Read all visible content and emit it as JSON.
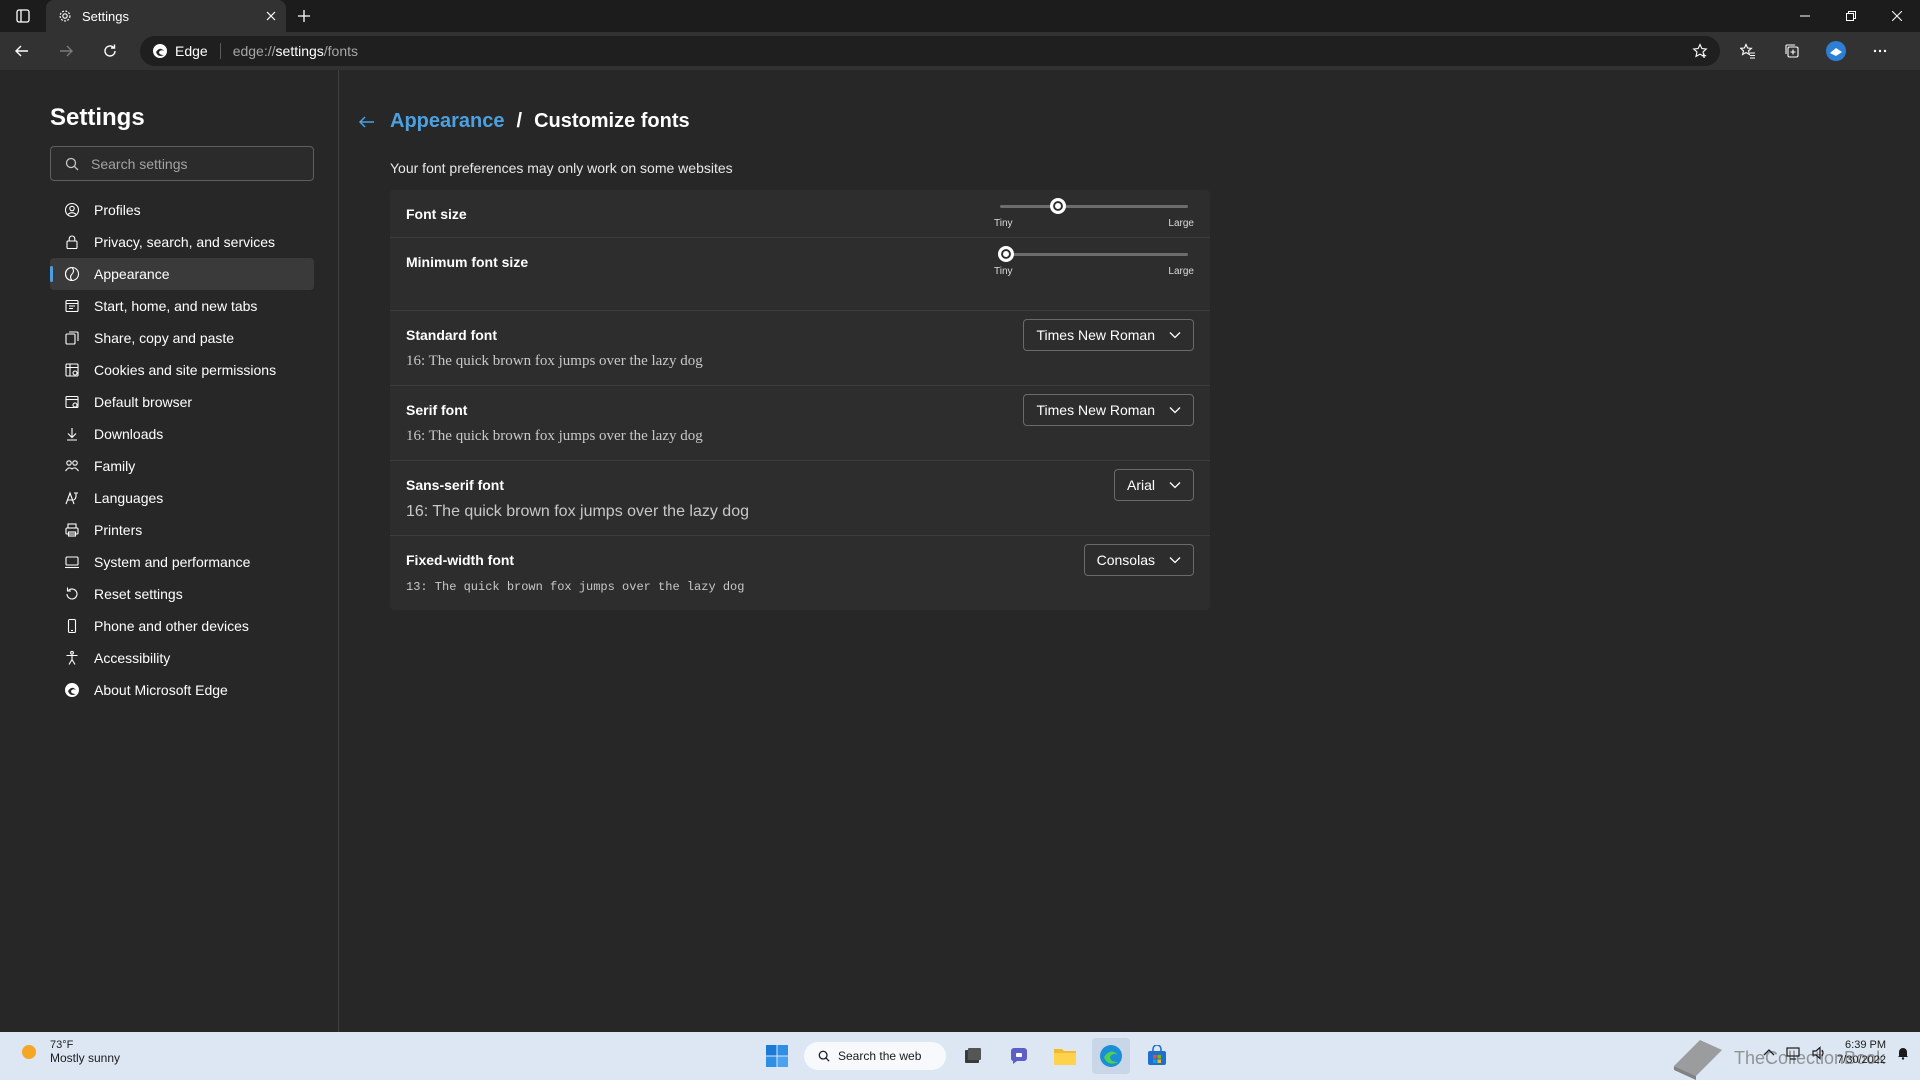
{
  "browser": {
    "tab_title": "Settings",
    "address_brand": "Edge",
    "url_prefix": "edge://",
    "url_bold": "settings",
    "url_suffix": "/fonts"
  },
  "sidebar": {
    "title": "Settings",
    "search_placeholder": "Search settings",
    "items": [
      {
        "label": "Profiles",
        "icon": "profile-icon"
      },
      {
        "label": "Privacy, search, and services",
        "icon": "lock-icon"
      },
      {
        "label": "Appearance",
        "icon": "appearance-icon",
        "active": true
      },
      {
        "label": "Start, home, and new tabs",
        "icon": "home-icon"
      },
      {
        "label": "Share, copy and paste",
        "icon": "share-icon"
      },
      {
        "label": "Cookies and site permissions",
        "icon": "cookies-icon"
      },
      {
        "label": "Default browser",
        "icon": "browser-icon"
      },
      {
        "label": "Downloads",
        "icon": "download-icon"
      },
      {
        "label": "Family",
        "icon": "family-icon"
      },
      {
        "label": "Languages",
        "icon": "language-icon"
      },
      {
        "label": "Printers",
        "icon": "printer-icon"
      },
      {
        "label": "System and performance",
        "icon": "system-icon"
      },
      {
        "label": "Reset settings",
        "icon": "reset-icon"
      },
      {
        "label": "Phone and other devices",
        "icon": "phone-icon"
      },
      {
        "label": "Accessibility",
        "icon": "accessibility-icon"
      },
      {
        "label": "About Microsoft Edge",
        "icon": "edge-icon"
      }
    ]
  },
  "main": {
    "breadcrumb_parent": "Appearance",
    "breadcrumb_separator": "/",
    "breadcrumb_current": "Customize fonts",
    "note": "Your font preferences may only work on some websites",
    "font_size": {
      "label": "Font size",
      "min_label": "Tiny",
      "max_label": "Large",
      "level": 0.3
    },
    "min_font_size": {
      "label": "Minimum font size",
      "min_label": "Tiny",
      "max_label": "Large",
      "level": 0.0
    },
    "standard_font": {
      "label": "Standard font",
      "value": "Times New Roman",
      "sample": "16: The quick brown fox jumps over the lazy dog"
    },
    "serif_font": {
      "label": "Serif font",
      "value": "Times New Roman",
      "sample": "16: The quick brown fox jumps over the lazy dog"
    },
    "sans_font": {
      "label": "Sans-serif font",
      "value": "Arial",
      "sample": "16: The quick brown fox jumps over the lazy dog"
    },
    "fixed_font": {
      "label": "Fixed-width font",
      "value": "Consolas",
      "sample": "13: The quick brown fox jumps over the lazy dog"
    }
  },
  "taskbar": {
    "temperature": "73°F",
    "weather": "Mostly sunny",
    "search_label": "Search the web",
    "time": "6:39 PM",
    "date": "7/30/2022",
    "watermark": "TheCollectionBook"
  },
  "colors": {
    "accent": "#4ca0e0",
    "background": "#272727",
    "card": "#2d2d2d"
  }
}
